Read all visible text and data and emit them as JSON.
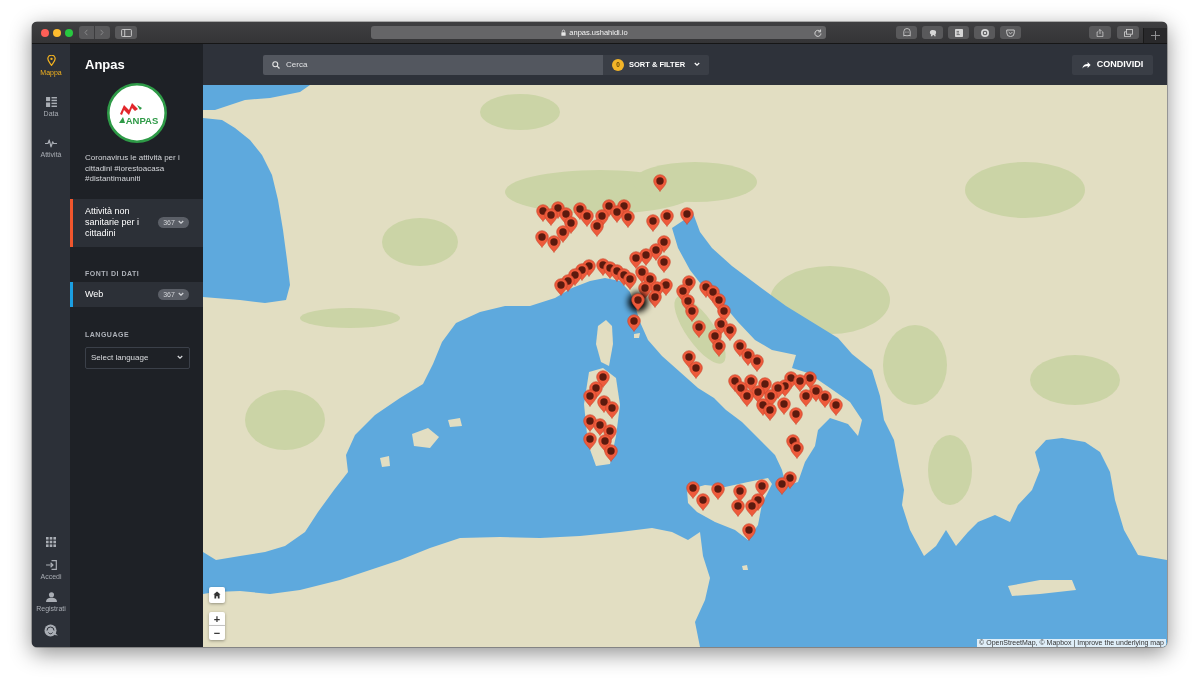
{
  "browser": {
    "url": "anpas.ushahidi.io"
  },
  "nav_rail": {
    "items": [
      {
        "kind": "map",
        "label": "Mappa",
        "selected": true
      },
      {
        "kind": "data",
        "label": "Data",
        "selected": false
      },
      {
        "kind": "activity",
        "label": "Attività",
        "selected": false
      }
    ],
    "footer_items": [
      {
        "kind": "apps"
      },
      {
        "kind": "login",
        "label": "Accedi"
      },
      {
        "kind": "signup",
        "label": "Registrati"
      },
      {
        "kind": "emblem"
      }
    ]
  },
  "sidebar": {
    "title": "Anpas",
    "logo_text": "ANPAS",
    "description": "Coronavirus le attività per i cittadini #iorestoacasa #distantimauniti",
    "categories": [
      {
        "label": "Attività non sanitarie per i cittadini",
        "count": "367",
        "color": "#f0562d"
      }
    ],
    "sources_heading": "FONTI DI DATI",
    "sources": [
      {
        "label": "Web",
        "count": "367",
        "color": "#1b9fe2"
      }
    ],
    "language_heading": "LANGUAGE",
    "language_select": {
      "value": "Select language"
    }
  },
  "toolbar": {
    "search": {
      "placeholder": "Cerca"
    },
    "filter_button": {
      "count": "0",
      "label": "SORT & FILTER"
    },
    "share_button": {
      "label": "CONDIVIDI"
    }
  },
  "map": {
    "controls": [
      {
        "kind": "home"
      },
      {
        "kind": "zoom_in",
        "label": "+"
      },
      {
        "kind": "zoom_out",
        "label": "−"
      }
    ],
    "attribution": "© OpenStreetMap, © Mapbox | Improve the underlying map"
  }
}
